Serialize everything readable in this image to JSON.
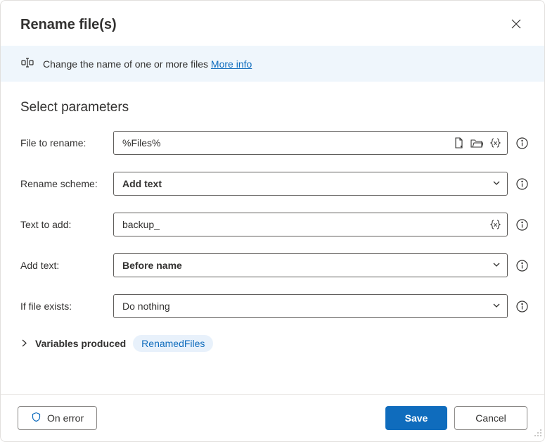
{
  "dialog": {
    "title": "Rename file(s)"
  },
  "banner": {
    "text": "Change the name of one or more files ",
    "link": "More info"
  },
  "section": {
    "title": "Select parameters"
  },
  "form": {
    "file_to_rename": {
      "label": "File to rename:",
      "value": "%Files%"
    },
    "rename_scheme": {
      "label": "Rename scheme:",
      "value": "Add text"
    },
    "text_to_add": {
      "label": "Text to add:",
      "value": "backup_"
    },
    "add_text": {
      "label": "Add text:",
      "value": "Before name"
    },
    "if_file_exists": {
      "label": "If file exists:",
      "value": "Do nothing"
    }
  },
  "variables": {
    "label": "Variables produced",
    "badge": "RenamedFiles"
  },
  "footer": {
    "on_error": "On error",
    "save": "Save",
    "cancel": "Cancel"
  }
}
